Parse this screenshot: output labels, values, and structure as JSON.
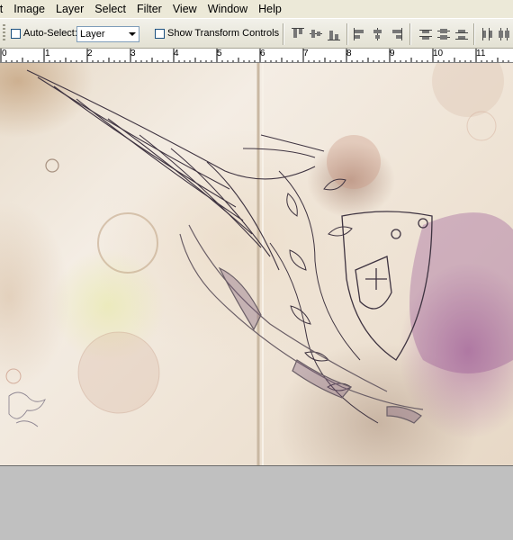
{
  "menubar": {
    "items": [
      "it",
      "Image",
      "Layer",
      "Select",
      "Filter",
      "View",
      "Window",
      "Help"
    ]
  },
  "options": {
    "auto_select_label": "Auto-Select:",
    "auto_select_checked": false,
    "layer_select_value": "Layer",
    "show_transform_label": "Show Transform Controls",
    "show_transform_checked": false
  },
  "ruler": {
    "unit": "inches",
    "labels": [
      "0",
      "1",
      "2",
      "3",
      "4",
      "5",
      "6",
      "7",
      "8",
      "9",
      "10",
      "11"
    ]
  },
  "colors": {
    "chrome": "#ece9d8",
    "workspace": "#c0c0c0",
    "art_line": "#4a3f4a",
    "purple_wash": "#a05a96"
  }
}
